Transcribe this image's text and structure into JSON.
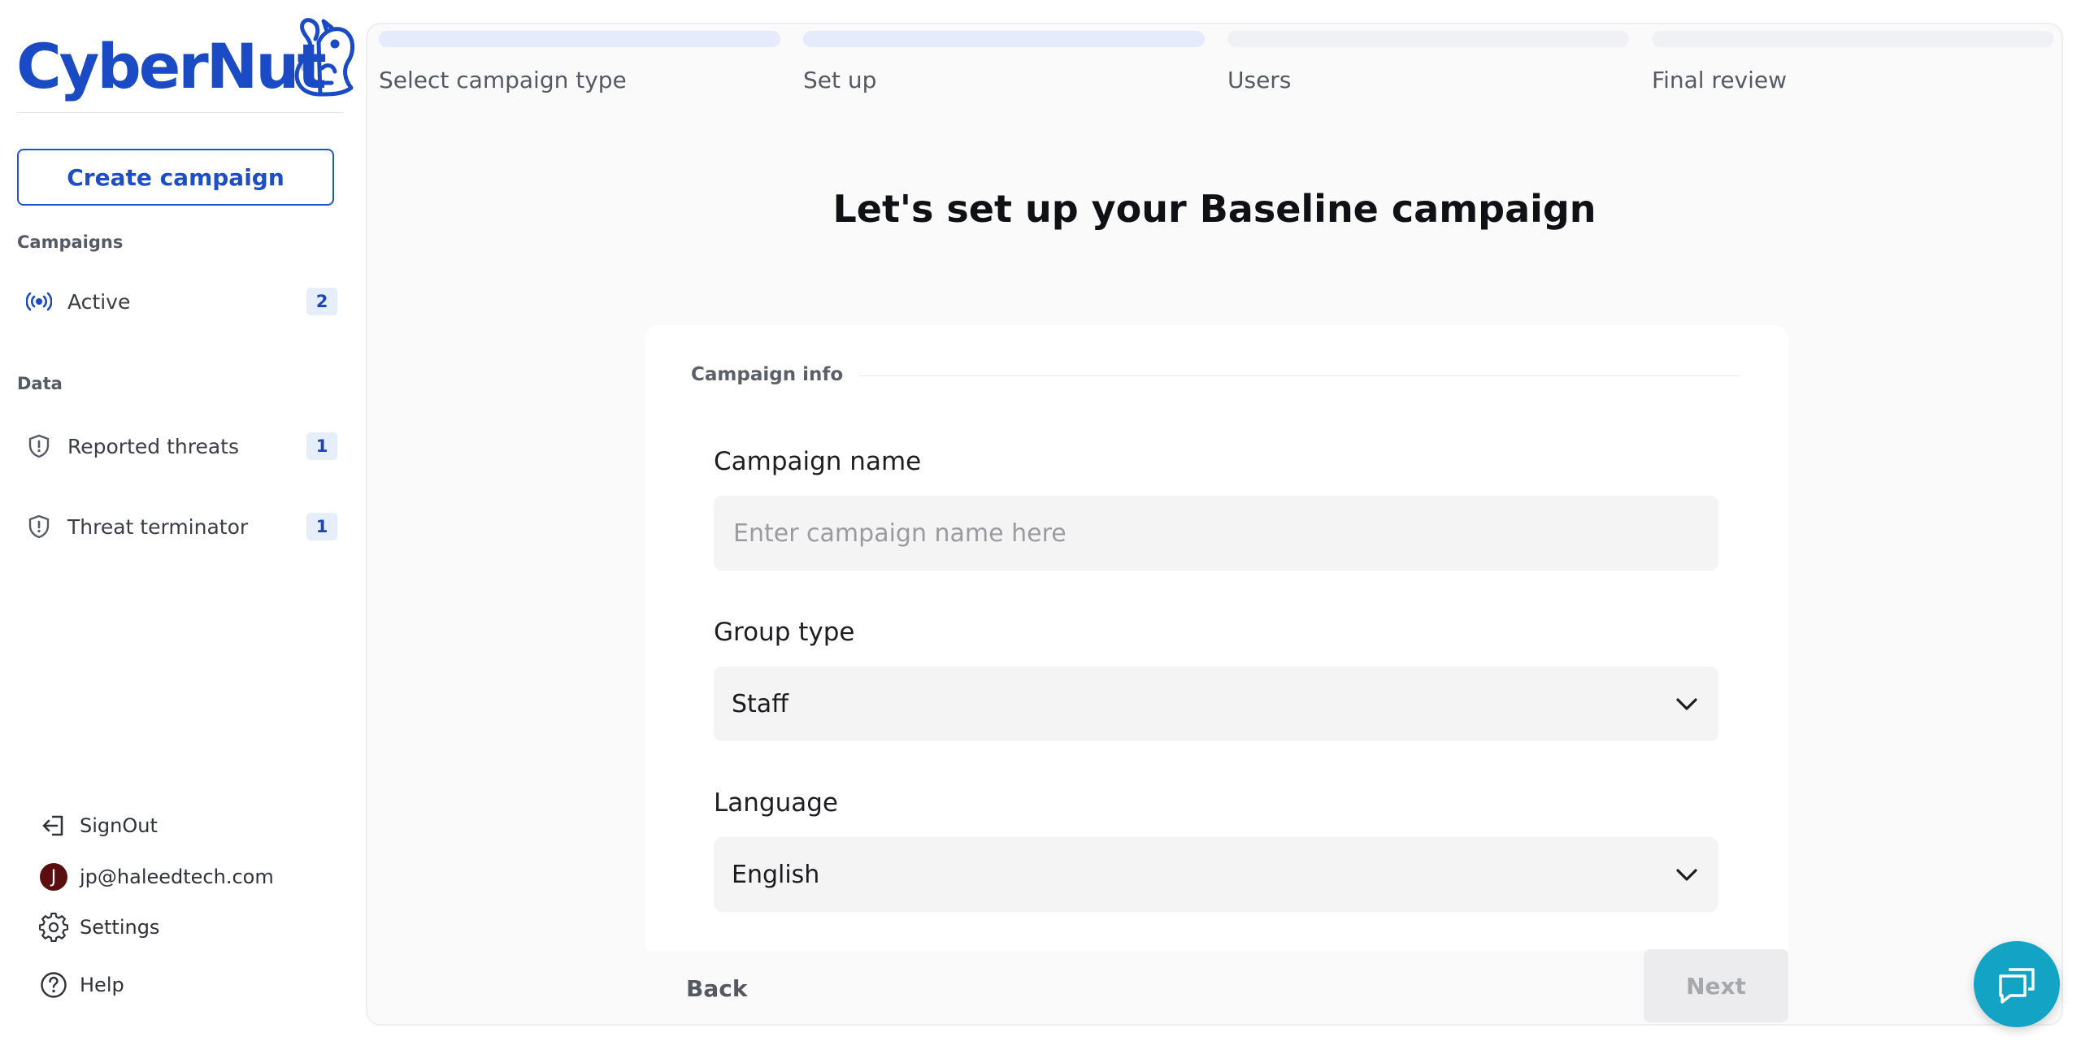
{
  "brand": {
    "name": "CyberNut",
    "color": "#1a4bc4"
  },
  "sidebar": {
    "create_button": "Create campaign",
    "campaigns_section": "Campaigns",
    "campaign_items": [
      {
        "label": "Active",
        "badge": "2",
        "icon": "broadcast-icon"
      }
    ],
    "data_section": "Data",
    "data_items": [
      {
        "label": "Reported threats",
        "badge": "1",
        "icon": "shield-alert-icon"
      },
      {
        "label": "Threat terminator",
        "badge": "1",
        "icon": "shield-alert-icon"
      }
    ],
    "footer": {
      "signout": "SignOut",
      "user_initial": "J",
      "user_email": "jp@haleedtech.com",
      "settings": "Settings",
      "help": "Help"
    }
  },
  "wizard": {
    "steps": [
      {
        "label": "Select campaign type",
        "state": "done"
      },
      {
        "label": "Set up",
        "state": "current"
      },
      {
        "label": "Users",
        "state": "pending"
      },
      {
        "label": "Final review",
        "state": "pending"
      }
    ],
    "heading": "Let's set up your Baseline campaign",
    "card": {
      "legend": "Campaign info",
      "campaign_name": {
        "label": "Campaign name",
        "value": "",
        "placeholder": "Enter campaign name here"
      },
      "group_type": {
        "label": "Group type",
        "value": "Staff"
      },
      "language": {
        "label": "Language",
        "value": "English"
      }
    },
    "back_label": "Back",
    "next_label": "Next"
  },
  "colors": {
    "accent": "#1d4ec4",
    "chat": "#13a4c5",
    "avatar": "#5a0e10"
  }
}
